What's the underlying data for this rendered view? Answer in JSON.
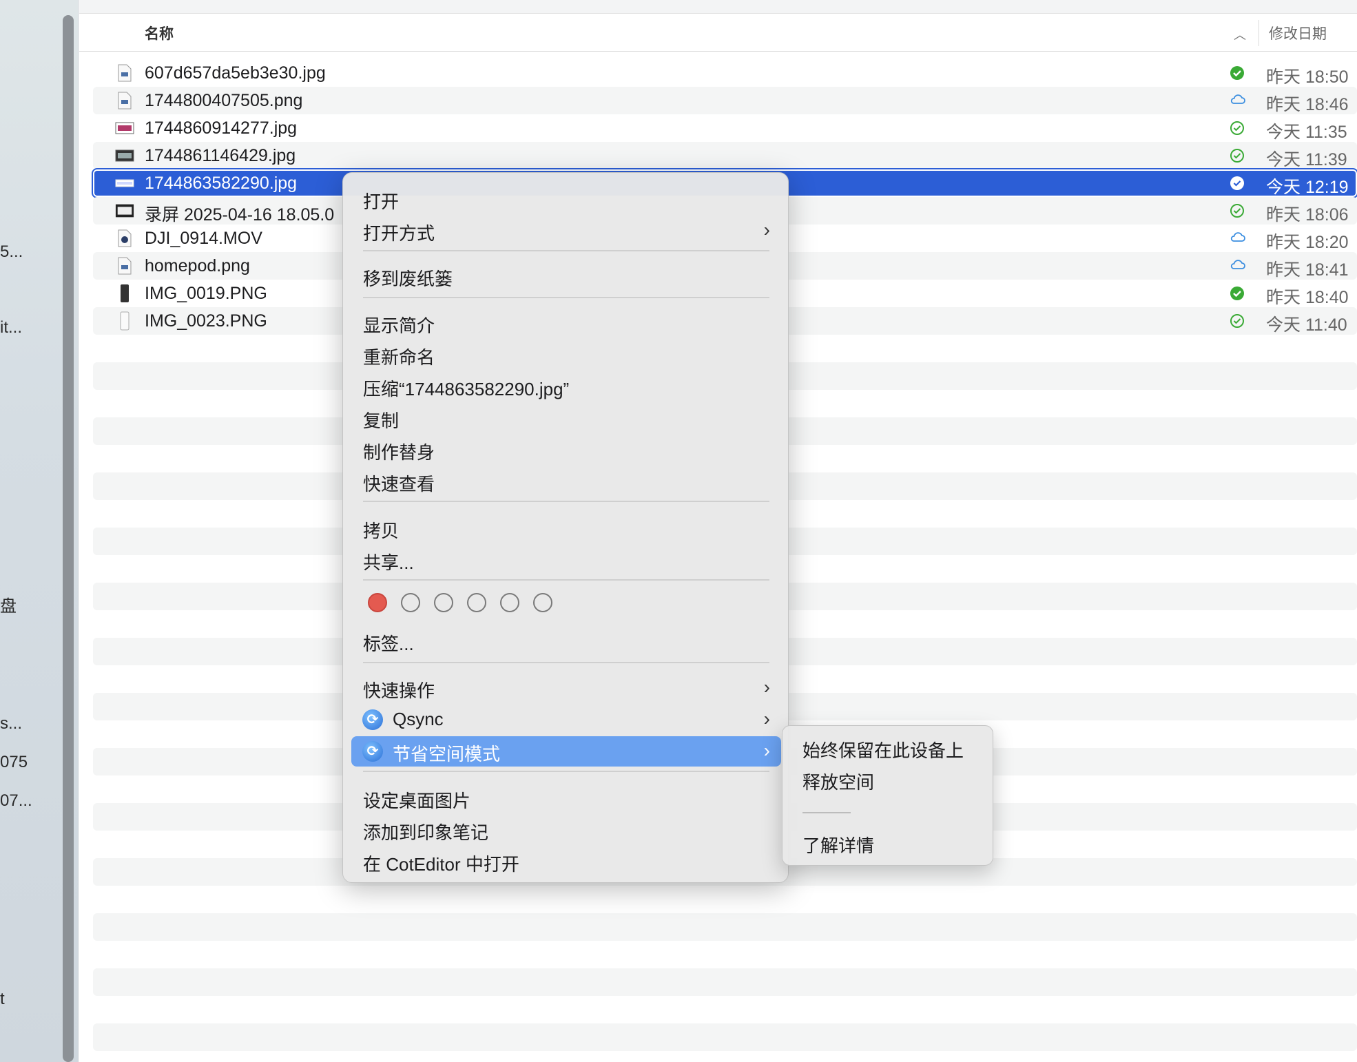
{
  "sidebar": {
    "items": [
      {
        "label": "5..."
      },
      {
        "label": "it..."
      },
      {
        "label": "盘"
      },
      {
        "label": "s..."
      },
      {
        "label": "075"
      },
      {
        "label": "07..."
      },
      {
        "label": "t"
      }
    ]
  },
  "header": {
    "name_col": "名称",
    "date_col": "修改日期",
    "sort_icon": "chevron-up-icon"
  },
  "files": [
    {
      "name": "607d657da5eb3e30.jpg",
      "date": "昨天 18:50",
      "status": "synced-filled",
      "icon": "image-doc-icon"
    },
    {
      "name": "1744800407505.png",
      "date": "昨天 18:46",
      "status": "cloud",
      "icon": "image-doc-icon"
    },
    {
      "name": "1744860914277.jpg",
      "date": "今天 11:35",
      "status": "synced-outline",
      "icon": "image-wide-icon"
    },
    {
      "name": "1744861146429.jpg",
      "date": "今天 11:39",
      "status": "synced-outline",
      "icon": "image-wide-dark-icon"
    },
    {
      "name": "1744863582290.jpg",
      "date": "今天 12:19",
      "status": "synced-outline",
      "icon": "image-strip-icon",
      "selected": true
    },
    {
      "name": "录屏 2025-04-16 18.05.0",
      "date": "昨天 18:06",
      "status": "synced-outline",
      "icon": "video-icon"
    },
    {
      "name": "DJI_0914.MOV",
      "date": "昨天 18:20",
      "status": "cloud",
      "icon": "movie-icon"
    },
    {
      "name": "homepod.png",
      "date": "昨天 18:41",
      "status": "cloud",
      "icon": "image-doc-icon"
    },
    {
      "name": "IMG_0019.PNG",
      "date": "昨天 18:40",
      "status": "synced-filled",
      "icon": "phone-screenshot-icon"
    },
    {
      "name": "IMG_0023.PNG",
      "date": "今天 11:40",
      "status": "synced-outline",
      "icon": "phone-screenshot-light-icon"
    }
  ],
  "context_menu": {
    "open": "打开",
    "open_with": "打开方式",
    "move_to_trash": "移到废纸篓",
    "get_info": "显示简介",
    "rename": "重新命名",
    "compress": "压缩“1744863582290.jpg”",
    "duplicate": "复制",
    "make_alias": "制作替身",
    "quick_look": "快速查看",
    "copy": "拷贝",
    "share": "共享...",
    "tags_label": "标签...",
    "tag_colors": [
      "#e45a50",
      "none",
      "none",
      "none",
      "none",
      "none"
    ],
    "quick_actions": "快速操作",
    "qsync": "Qsync",
    "space_saving": "节省空间模式",
    "set_desktop": "设定桌面图片",
    "add_evernote": "添加到印象笔记",
    "open_coteditor": "在 CotEditor 中打开"
  },
  "submenu": {
    "keep_on_device": "始终保留在此设备上",
    "free_space": "释放空间",
    "learn_more": "了解详情"
  },
  "colors": {
    "selection": "#2c5ed6",
    "menu_highlight": "#6aa1f0",
    "synced_green": "#3aaa35",
    "cloud_blue": "#3b8ee0"
  }
}
